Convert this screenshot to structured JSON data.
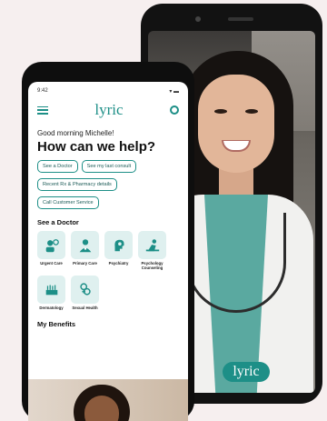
{
  "back_phone": {
    "brand_badge": "lyric"
  },
  "app": {
    "status_time": "9:42",
    "logo": "lyric",
    "greeting": "Good morning Michelle!",
    "headline": "How can we help?",
    "quick_actions": [
      "See a Doctor",
      "See my last consult",
      "Recent Rx & Pharmacy details",
      "Call Customer Service"
    ],
    "section_see_doctor": "See a Doctor",
    "services": [
      {
        "label": "Urgent Care",
        "icon": "urgent-care-icon"
      },
      {
        "label": "Primary Care",
        "icon": "primary-care-icon"
      },
      {
        "label": "Psychiatry",
        "icon": "psychiatry-icon"
      },
      {
        "label": "Psychology Counseling",
        "icon": "psychology-icon"
      },
      {
        "label": "Dermatology",
        "icon": "dermatology-icon"
      },
      {
        "label": "Sexual Health",
        "icon": "sexual-health-icon"
      }
    ],
    "section_benefits": "My Benefits"
  },
  "colors": {
    "brand": "#1d8f87",
    "tile_bg": "#dff0ef"
  }
}
